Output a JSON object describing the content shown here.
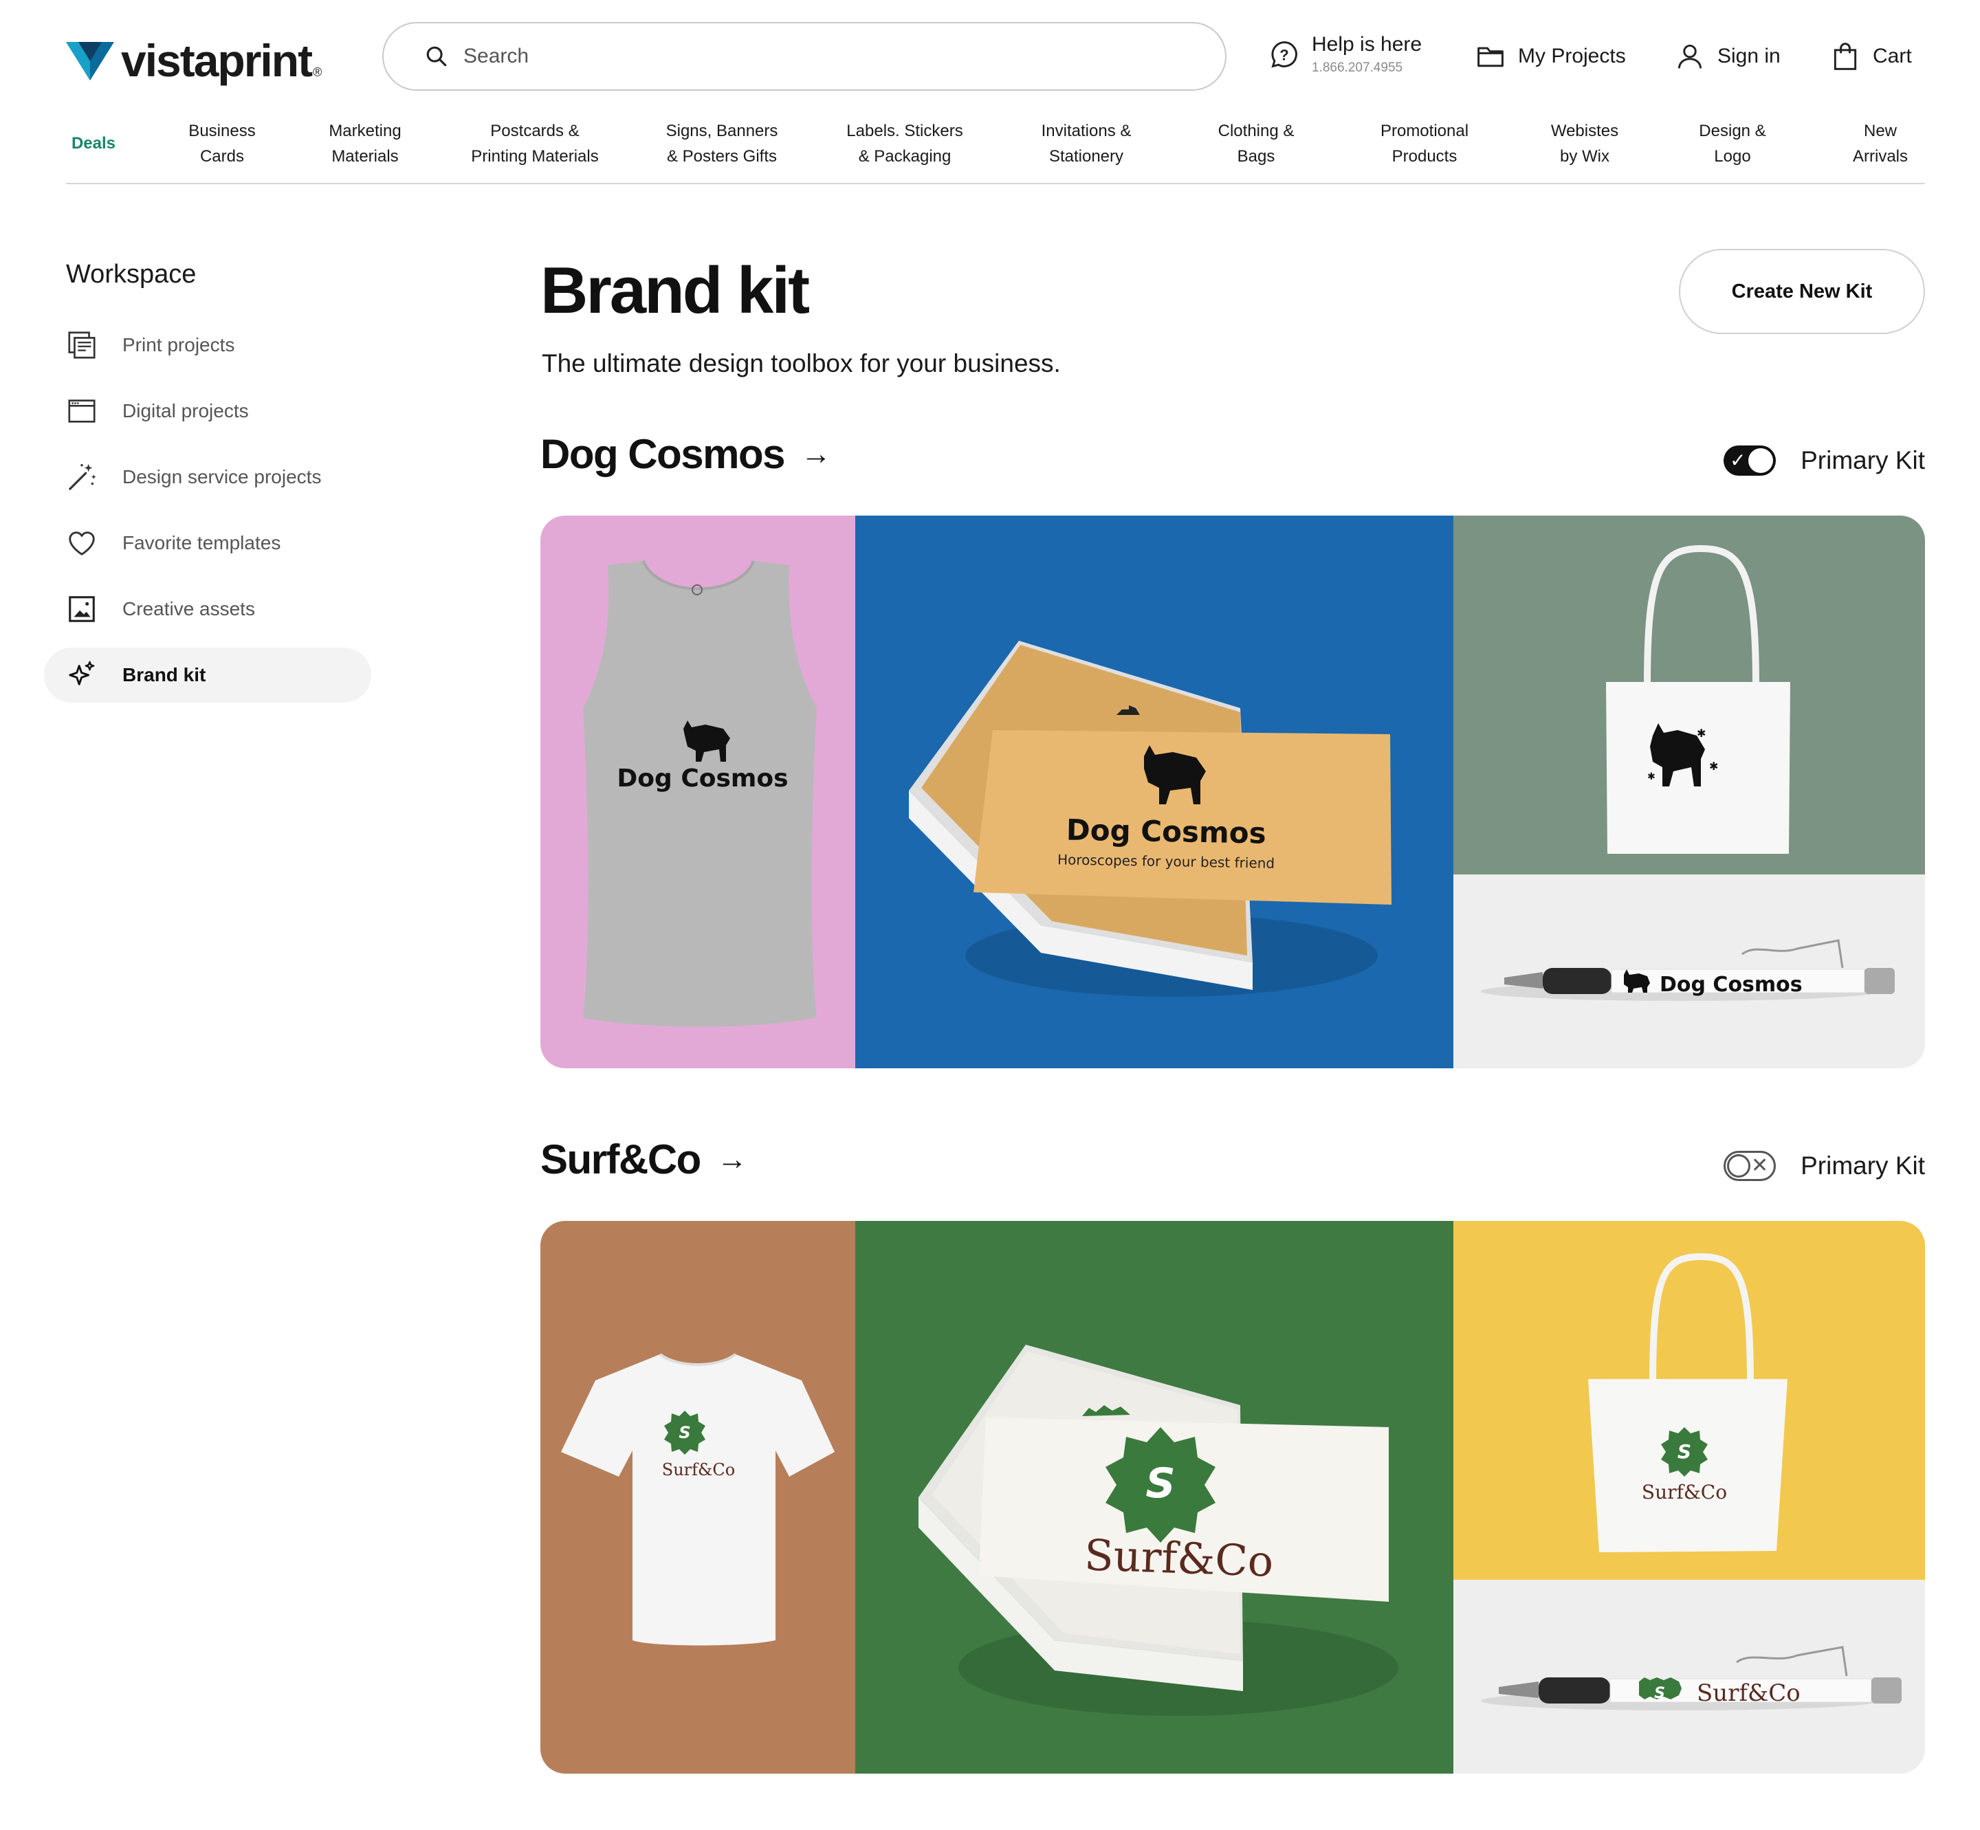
{
  "brand": {
    "name": "vistaprint",
    "reg": "®"
  },
  "search": {
    "placeholder": "Search"
  },
  "header": {
    "help_label": "Help is here",
    "help_phone": "1.866.207.4955",
    "my_projects": "My Projects",
    "sign_in": "Sign in",
    "cart": "Cart"
  },
  "nav": [
    {
      "line1": "Deals",
      "line2": ""
    },
    {
      "line1": "Business",
      "line2": "Cards"
    },
    {
      "line1": "Marketing",
      "line2": "Materials"
    },
    {
      "line1": "Postcards &",
      "line2": "Printing Materials"
    },
    {
      "line1": "Signs, Banners",
      "line2": "& Posters Gifts"
    },
    {
      "line1": "Labels. Stickers",
      "line2": "& Packaging"
    },
    {
      "line1": "Invitations &",
      "line2": "Stationery"
    },
    {
      "line1": "Clothing &",
      "line2": "Bags"
    },
    {
      "line1": "Promotional",
      "line2": "Products"
    },
    {
      "line1": "Webistes",
      "line2": "by Wix"
    },
    {
      "line1": "Design &",
      "line2": "Logo"
    },
    {
      "line1": "New",
      "line2": "Arrivals"
    }
  ],
  "sidebar": {
    "title": "Workspace",
    "items": [
      {
        "label": "Print projects",
        "icon": "print-projects-icon",
        "active": false
      },
      {
        "label": "Digital projects",
        "icon": "browser-window-icon",
        "active": false
      },
      {
        "label": "Design service projects",
        "icon": "magic-wand-icon",
        "active": false
      },
      {
        "label": "Favorite templates",
        "icon": "heart-icon",
        "active": false
      },
      {
        "label": "Creative assets",
        "icon": "image-icon",
        "active": false
      },
      {
        "label": "Brand kit",
        "icon": "sparkle-icon",
        "active": true
      }
    ]
  },
  "main": {
    "title": "Brand kit",
    "subtitle": "The ultimate design toolbox for your business.",
    "create_button": "Create New Kit",
    "primary_label": "Primary Kit"
  },
  "kits": [
    {
      "name": "Dog Cosmos",
      "primary": true,
      "tank_text": "Dog Cosmos",
      "card_title": "Dog Cosmos",
      "card_tagline": "Horoscopes for your best friend",
      "pen_text": "Dog Cosmos",
      "colors": {
        "tank_bg": "#e2a9d6",
        "card_bg": "#1b68ae",
        "card": "#e9b870",
        "tote_bg": "#7a9383",
        "pen_bg": "#eeeeee"
      }
    },
    {
      "name": "Surf&Co",
      "primary": false,
      "shirt_text": "Surf&Co",
      "card_title": "Surf&Co",
      "tote_text": "Surf&Co",
      "pen_text": "Surf&Co",
      "badge_letter": "S",
      "colors": {
        "shirt_bg": "#b67f59",
        "card_bg": "#3f7a42",
        "card": "#f6f4ef",
        "tote_bg": "#f3c84f",
        "pen_bg": "#eeeeee",
        "brand": "#3a7a3c",
        "wordmark": "#5a2a1f"
      }
    }
  ]
}
